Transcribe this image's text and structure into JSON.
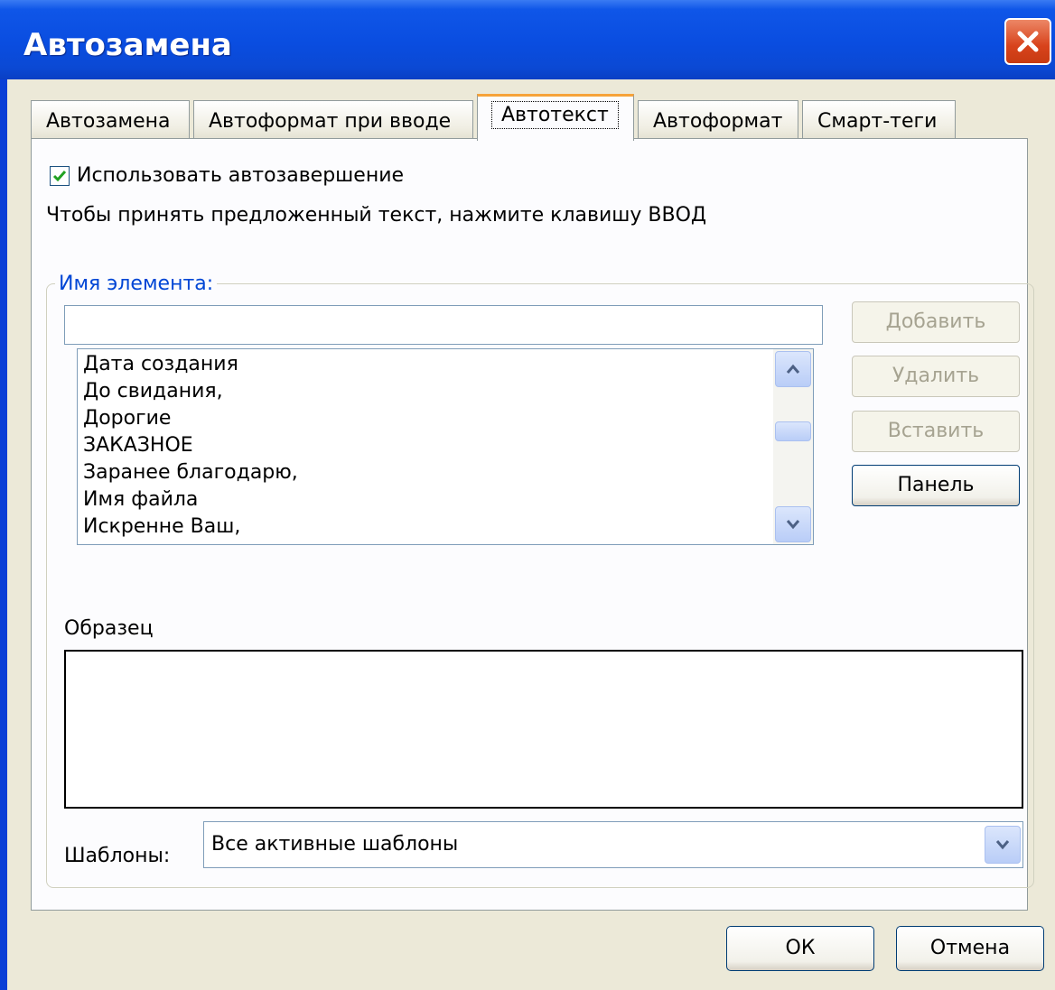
{
  "window": {
    "title": "Автозамена"
  },
  "tabs": [
    {
      "label": "Автозамена"
    },
    {
      "label": "Автоформат при вводе"
    },
    {
      "label": "Автотекст"
    },
    {
      "label": "Автоформат"
    },
    {
      "label": "Смарт-теги"
    }
  ],
  "active_tab": "Автотекст",
  "autocomplete": {
    "label": "Использовать автозавершение",
    "checked": true
  },
  "hint": "Чтобы принять предложенный текст, нажмите клавишу ВВОД",
  "element": {
    "label": "Имя элемента:",
    "value": "",
    "items": [
      "Дата создания",
      "До свидания,",
      "Дорогие",
      "ЗАКАЗНОЕ",
      "Заранее благодарю,",
      "Имя файла",
      "Искренне Ваш,"
    ]
  },
  "buttons": {
    "add": "Добавить",
    "delete": "Удалить",
    "insert": "Вставить",
    "panel": "Панель",
    "ok": "ОК",
    "cancel": "Отмена"
  },
  "sample": {
    "label": "Образец"
  },
  "templates": {
    "label": "Шаблоны:",
    "value": "Все активные шаблоны"
  },
  "colors": {
    "titlebar": "#0a4de0",
    "dialog": "#ece9d8",
    "active_tab_accent": "#f6a33a",
    "close": "#d8431c"
  }
}
